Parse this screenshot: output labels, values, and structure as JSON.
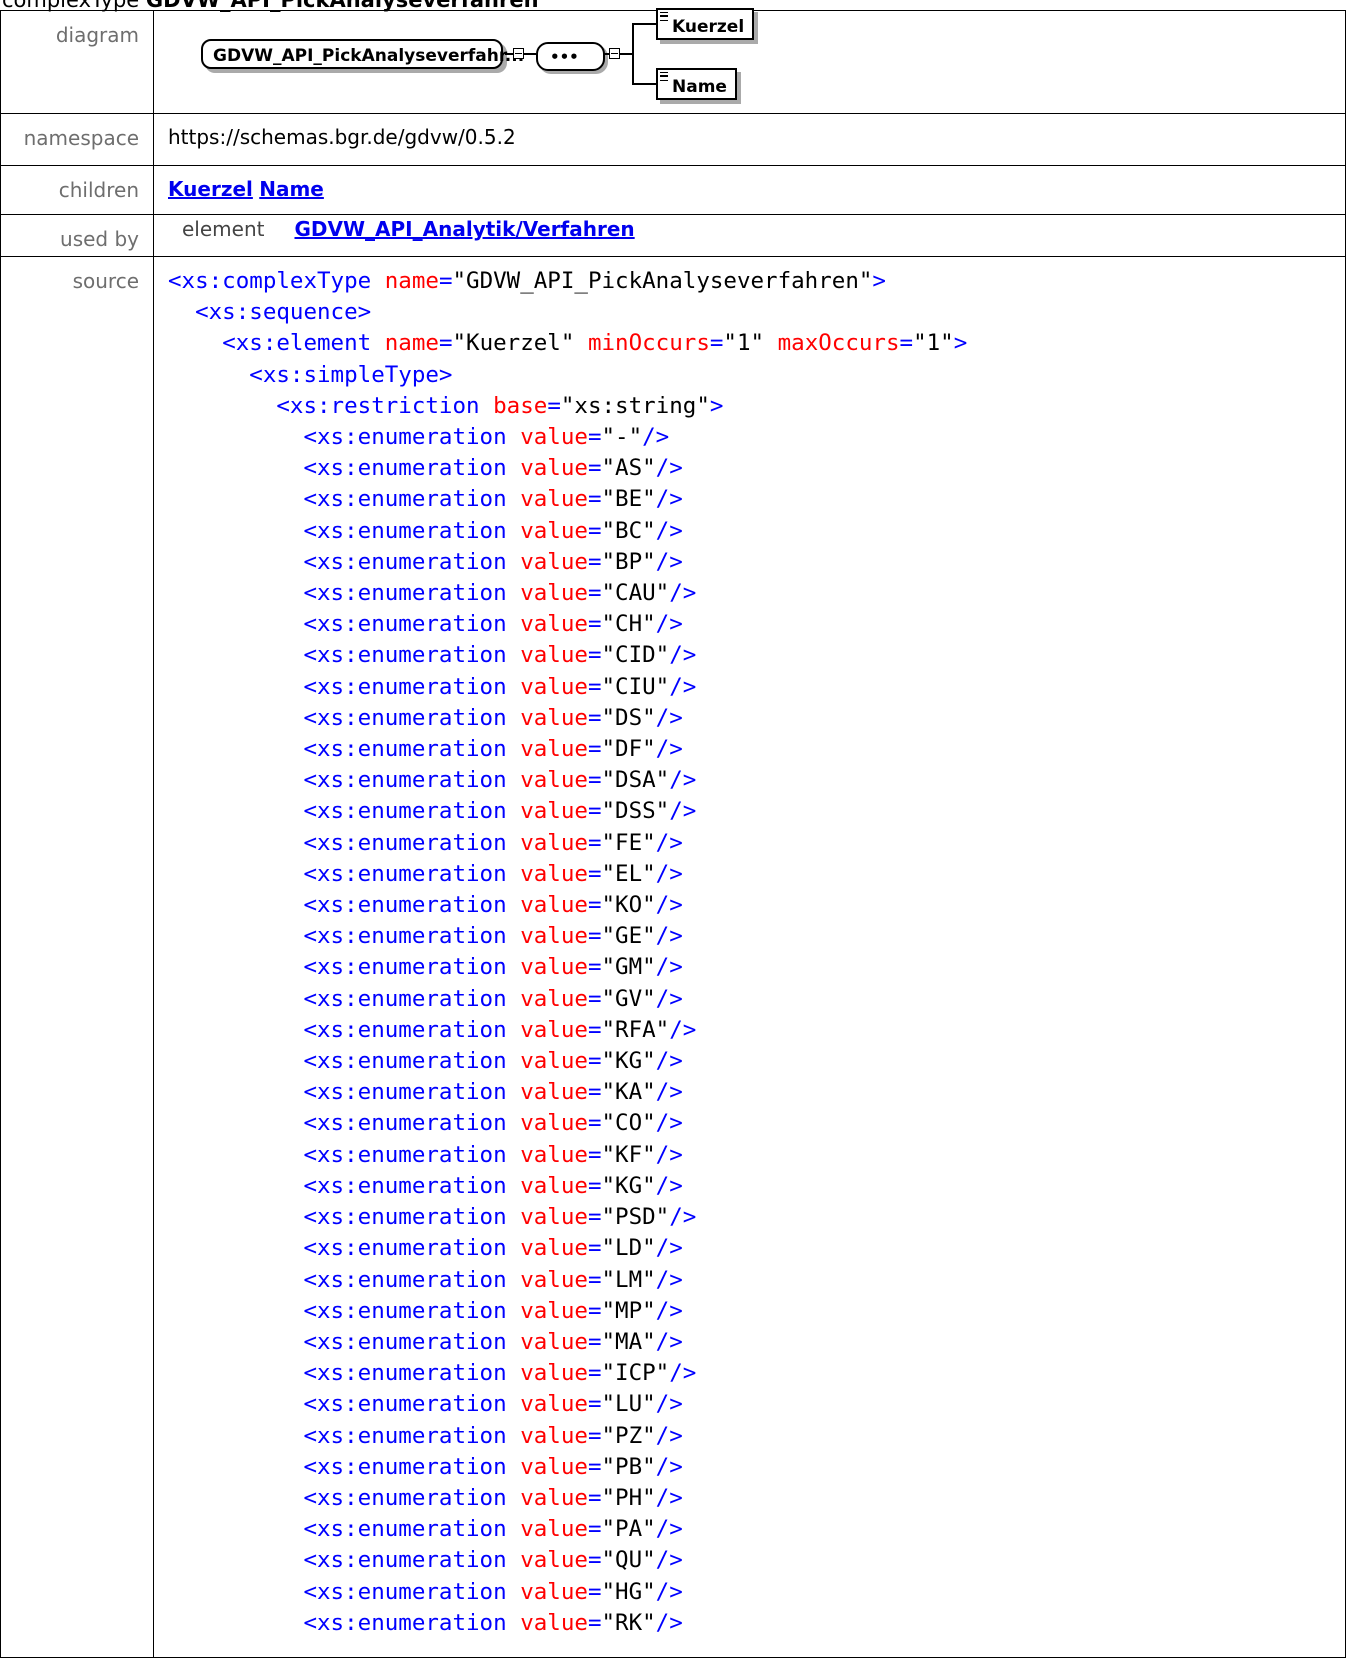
{
  "header": {
    "prefix": "complexType ",
    "name": "GDVW_API_PickAnalyseverfahren"
  },
  "rows": {
    "diagram_label": "diagram",
    "namespace_label": "namespace",
    "namespace_value": "https://schemas.bgr.de/gdvw/0.5.2",
    "children_label": "children",
    "children": [
      "Kuerzel",
      "Name"
    ],
    "usedby_label": "used by",
    "usedby_kind": "element",
    "usedby_link": "GDVW_API_Analytik/Verfahren",
    "source_label": "source"
  },
  "diagram": {
    "main_box": "GDVW_API_PickAnalyseverfahr...",
    "sequence_symbol": "•••",
    "child_1": "Kuerzel",
    "child_2": "Name"
  },
  "source": {
    "complex_name": "GDVW_API_PickAnalyseverfahren",
    "element_name": "Kuerzel",
    "min_occurs": "1",
    "max_occurs": "1",
    "restriction_base": "xs:string",
    "enumerations": [
      "-",
      "AS",
      "BE",
      "BC",
      "BP",
      "CAU",
      "CH",
      "CID",
      "CIU",
      "DS",
      "DF",
      "DSA",
      "DSS",
      "FE",
      "EL",
      "KO",
      "GE",
      "GM",
      "GV",
      "RFA",
      "KG",
      "KA",
      "CO",
      "KF",
      "KG",
      "PSD",
      "LD",
      "LM",
      "MP",
      "MA",
      "ICP",
      "LU",
      "PZ",
      "PB",
      "PH",
      "PA",
      "QU",
      "HG",
      "RK"
    ]
  },
  "colors": {
    "tag": "#0000ff",
    "attr": "#ff0000",
    "link": "#0000ee",
    "label": "#6e6e6e"
  }
}
